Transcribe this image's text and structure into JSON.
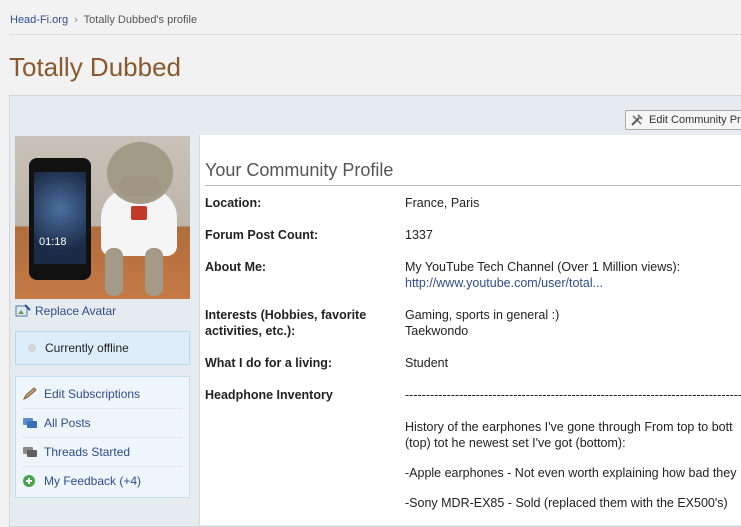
{
  "breadcrumb": {
    "site": "Head-Fi.org",
    "separator": "›",
    "current": "Totally Dubbed's profile"
  },
  "page_title": "Totally Dubbed",
  "toolbar": {
    "edit_label": "Edit Community Prof"
  },
  "avatar": {
    "phone_time": "01:18"
  },
  "sidebar": {
    "replace_avatar": "Replace Avatar",
    "status": "Currently offline",
    "links": [
      {
        "label": "Edit Subscriptions",
        "icon": "pencil-icon"
      },
      {
        "label": "All Posts",
        "icon": "posts-icon"
      },
      {
        "label": "Threads Started",
        "icon": "threads-icon"
      },
      {
        "label": "My Feedback (+4)",
        "icon": "plus-circle-icon"
      }
    ]
  },
  "profile": {
    "title": "Your Community Profile",
    "location_label": "Location:",
    "location_value": "France, Paris",
    "post_count_label": "Forum Post Count:",
    "post_count_value": "1337",
    "about_label": "About Me:",
    "about_value": "My YouTube Tech Channel (Over 1 Million views):",
    "about_link": "http://www.youtube.com/user/total...",
    "interests_label_1": "Interests (Hobbies, favorite",
    "interests_label_2": "activities, etc.):",
    "interests_value_1": "Gaming, sports in general :)",
    "interests_value_2": "Taekwondo",
    "living_label": "What I do for a living:",
    "living_value": "Student",
    "inventory_label": "Headphone Inventory",
    "inventory_rule": "---------------------------------------------------------------------------------------------------",
    "inventory_line_1": "History of the earphones I've gone through From top to bott",
    "inventory_line_2": "(top) tot he newest set I've got (bottom):",
    "inventory_line_3": "-Apple earphones - Not even worth explaining how bad they",
    "inventory_line_4": "-Sony MDR-EX85 - Sold (replaced them with the EX500's)"
  }
}
